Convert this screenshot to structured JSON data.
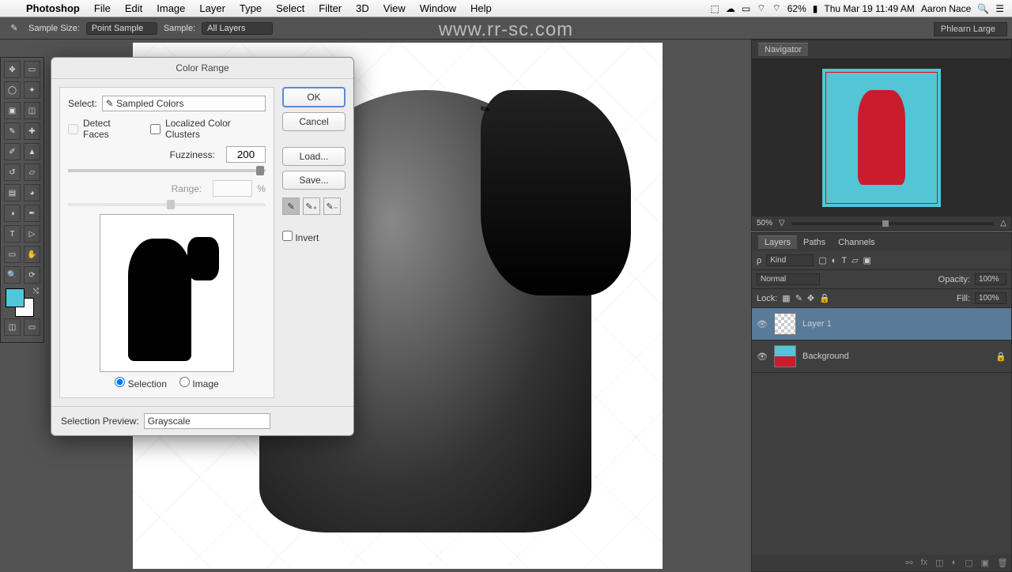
{
  "menubar": {
    "app": "Photoshop",
    "items": [
      "File",
      "Edit",
      "Image",
      "Layer",
      "Type",
      "Select",
      "Filter",
      "3D",
      "View",
      "Window",
      "Help"
    ],
    "battery": "62%",
    "datetime": "Thu Mar 19  11:49 AM",
    "user": "Aaron Nace"
  },
  "watermark_url": "www.rr-sc.com",
  "options_bar": {
    "sample_size_label": "Sample Size:",
    "sample_size_value": "Point Sample",
    "sample_label": "Sample:",
    "sample_value": "All Layers"
  },
  "workspace": "Phlearn Large",
  "navigator": {
    "title": "Navigator",
    "zoom": "50%"
  },
  "layers_panel": {
    "tabs": [
      "Layers",
      "Paths",
      "Channels"
    ],
    "kind_label": "Kind",
    "blend_mode": "Normal",
    "opacity_label": "Opacity:",
    "opacity_value": "100%",
    "lock_label": "Lock:",
    "fill_label": "Fill:",
    "fill_value": "100%",
    "layers": [
      {
        "name": "Layer 1",
        "visible": true,
        "selected": true,
        "locked": false
      },
      {
        "name": "Background",
        "visible": true,
        "selected": false,
        "locked": true
      }
    ]
  },
  "dialog": {
    "title": "Color Range",
    "select_label": "Select:",
    "select_value": "Sampled Colors",
    "detect_faces": "Detect Faces",
    "localized": "Localized Color Clusters",
    "fuzziness_label": "Fuzziness:",
    "fuzziness_value": "200",
    "range_label": "Range:",
    "range_unit": "%",
    "radio_selection": "Selection",
    "radio_image": "Image",
    "preview_label": "Selection Preview:",
    "preview_value": "Grayscale",
    "ok": "OK",
    "cancel": "Cancel",
    "load": "Load...",
    "save": "Save...",
    "invert": "Invert"
  }
}
